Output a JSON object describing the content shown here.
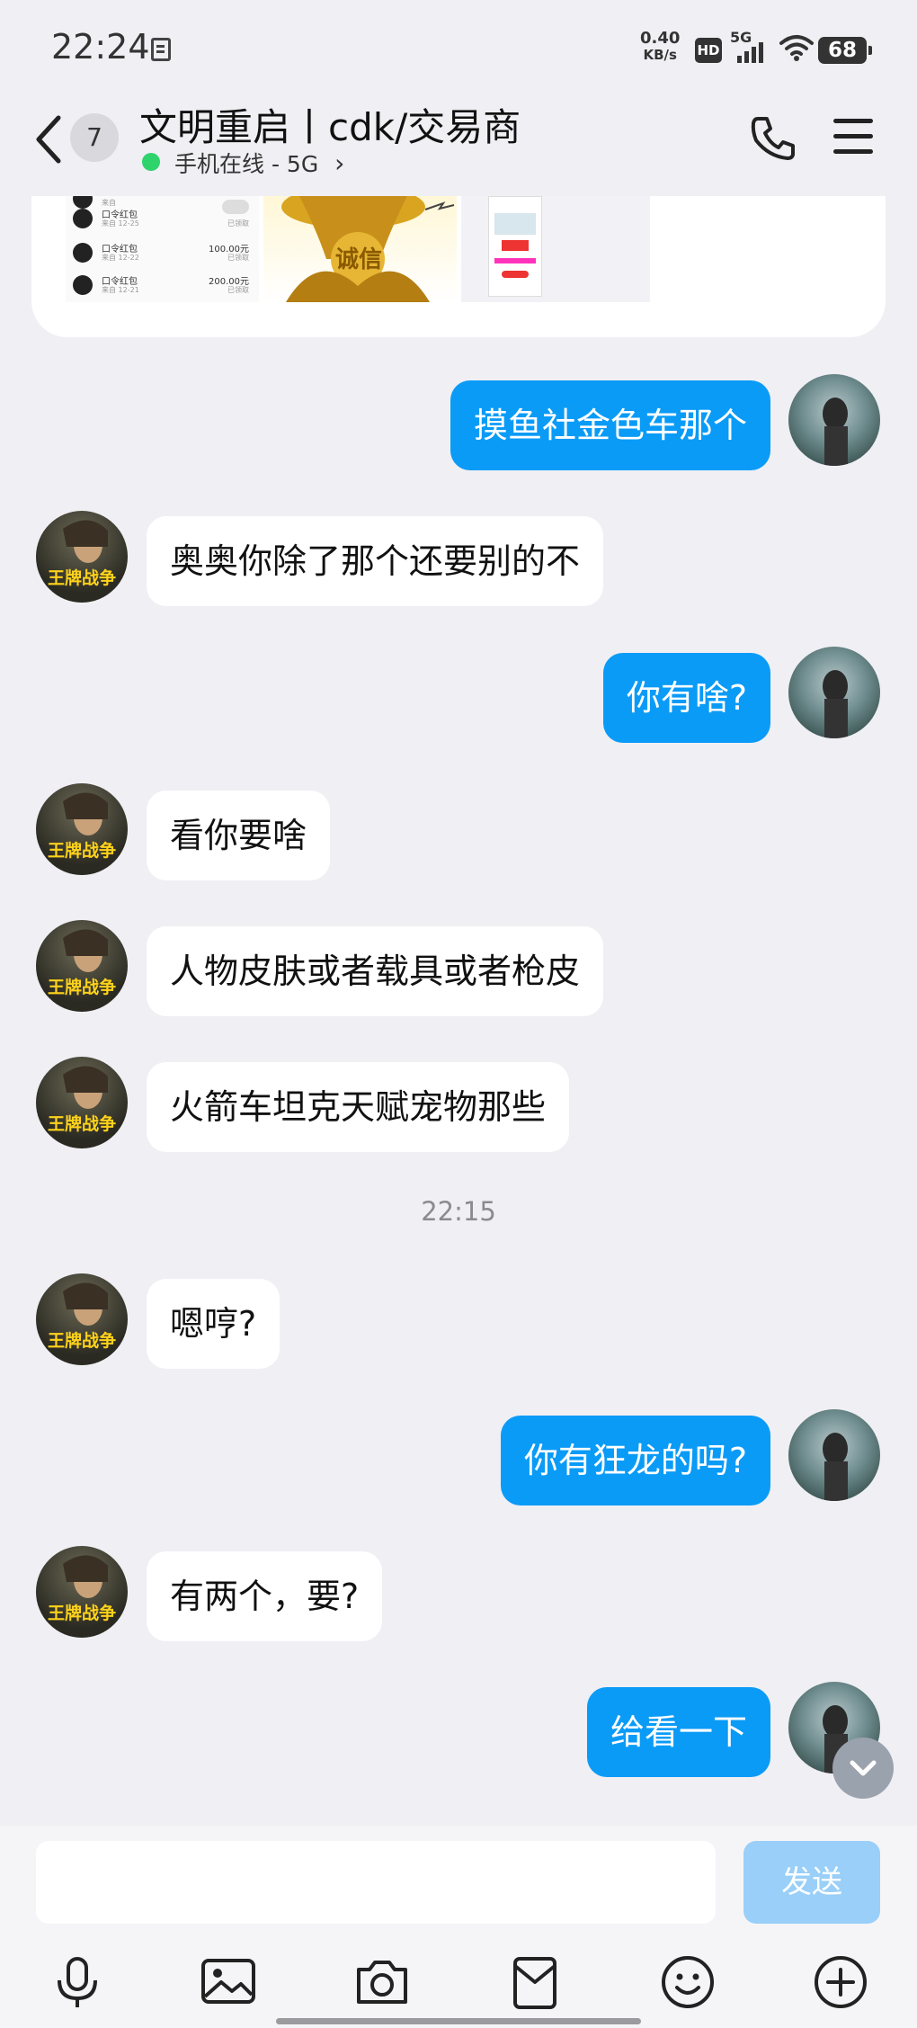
{
  "status_bar": {
    "time": "22:24",
    "net_speed_value": "0.40",
    "net_speed_unit": "KB/s",
    "hd": "HD",
    "network": "5G",
    "battery": "68"
  },
  "header": {
    "unread_count": "7",
    "title": "文明重启丨cdk/交易商",
    "status": "手机在线 - 5G",
    "chevron": "›"
  },
  "card": {
    "rows": [
      {
        "title": "口令红包",
        "sub": "来自 ",
        "amount": "",
        "state": ""
      },
      {
        "title": "口令红包",
        "sub": "来自 12-25",
        "amount": "",
        "state": "已领取"
      },
      {
        "title": "口令红包",
        "sub": "来自 12-22",
        "amount": "100.00元",
        "state": "已领取"
      },
      {
        "title": "口令红包",
        "sub": "来自 12-21",
        "amount": "200.00元",
        "state": "已领取"
      }
    ],
    "seal_text": "诚信"
  },
  "messages": [
    {
      "side": "out",
      "text": "摸鱼社金色车那个"
    },
    {
      "side": "in",
      "text": "奥奥你除了那个还要别的不"
    },
    {
      "side": "out",
      "text": "你有啥?"
    },
    {
      "side": "in",
      "text": "看你要啥"
    },
    {
      "side": "in",
      "text": "人物皮肤或者载具或者枪皮"
    },
    {
      "side": "in",
      "text": "火箭车坦克天赋宠物那些"
    },
    {
      "side": "time",
      "text": "22:15"
    },
    {
      "side": "in",
      "text": "嗯哼?"
    },
    {
      "side": "out",
      "text": "你有狂龙的吗?"
    },
    {
      "side": "in",
      "text": "有两个，要?"
    },
    {
      "side": "out",
      "text": "给看一下"
    }
  ],
  "avatar_other_text": "王牌战争",
  "input": {
    "value": "",
    "send_label": "发送"
  },
  "toolbar": [
    "microphone-icon",
    "image-icon",
    "camera-icon",
    "red-packet-icon",
    "emoji-icon",
    "plus-icon"
  ],
  "colors": {
    "background": "#efeff4",
    "bubble_out": "#0a9bf7",
    "bubble_in": "#ffffff",
    "send_disabled": "#99cff8",
    "online": "#2fd36b"
  }
}
